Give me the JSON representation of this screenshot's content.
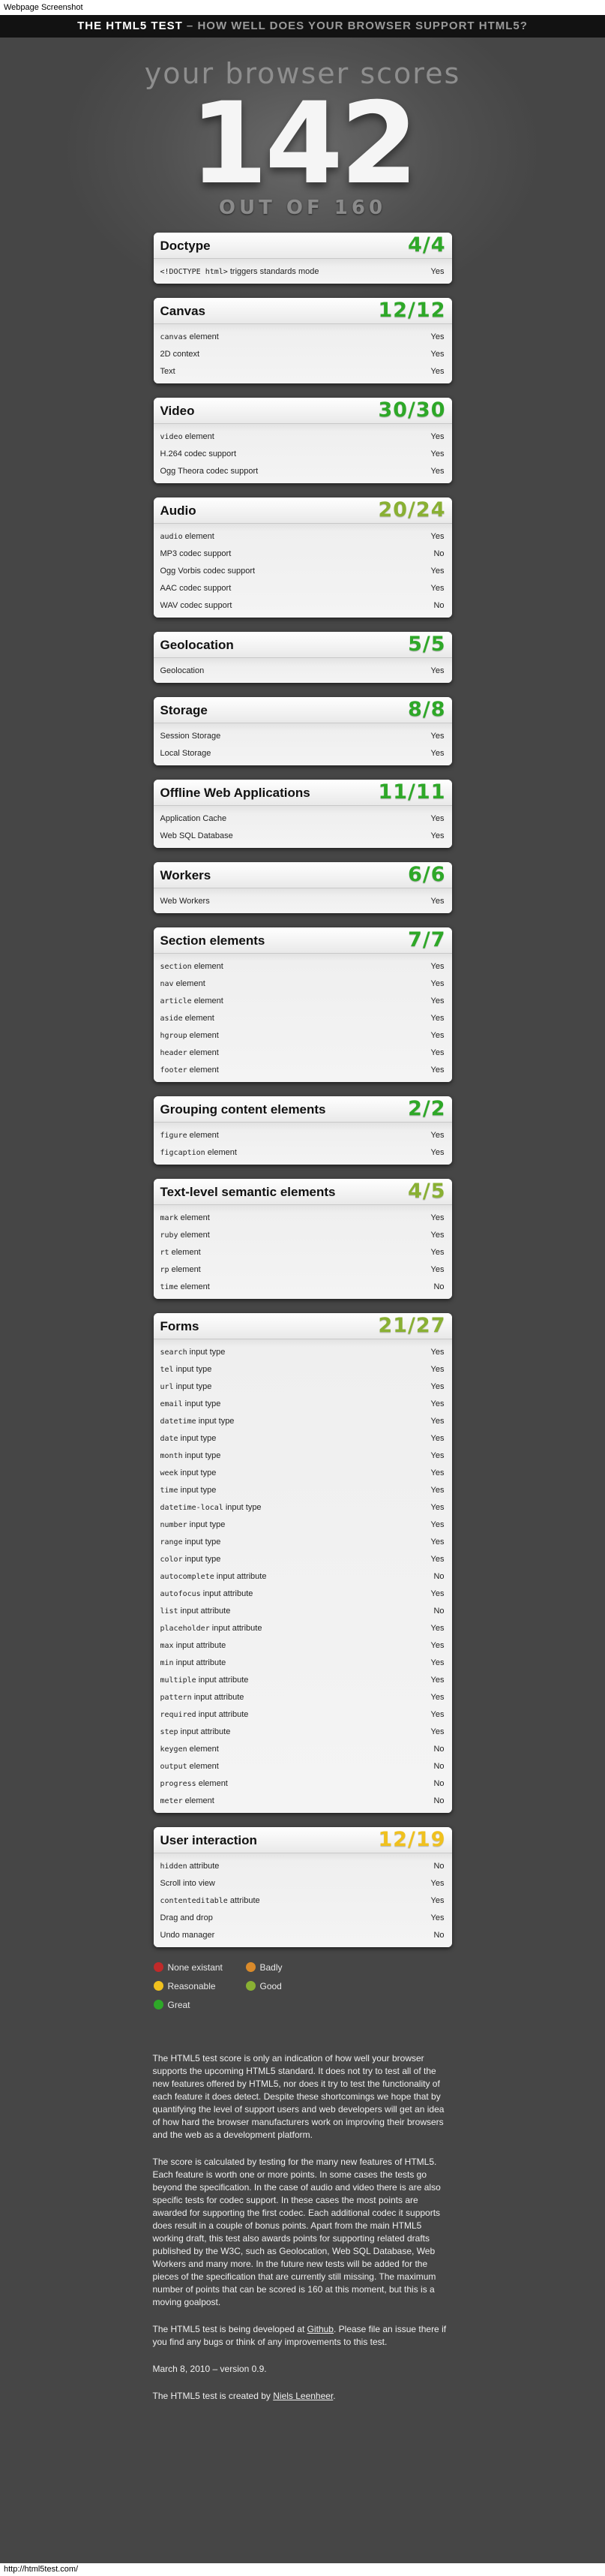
{
  "screenshot_caption": "Webpage Screenshot",
  "status_url": "http://html5test.com/",
  "header": {
    "strong": "THE HTML5 TEST",
    "rest": " – HOW WELL DOES YOUR BROWSER SUPPORT HTML5?"
  },
  "hero": {
    "lead": "your browser scores",
    "score": "142",
    "out_of": "OUT OF 160"
  },
  "colors": {
    "great": "#2ea828",
    "good": "#89b033",
    "reasonable": "#f0c11e",
    "badly": "#d98a2b",
    "none": "#c02a2a"
  },
  "sections": [
    {
      "title": "Doctype",
      "score": "4/4",
      "rating": "great",
      "rows": [
        {
          "pre": "",
          "code": "<!DOCTYPE html>",
          "post": " triggers standards mode",
          "result": "Yes"
        }
      ]
    },
    {
      "title": "Canvas",
      "score": "12/12",
      "rating": "great",
      "rows": [
        {
          "pre": "",
          "code": "canvas",
          "post": " element",
          "result": "Yes"
        },
        {
          "pre": "2D context",
          "code": "",
          "post": "",
          "result": "Yes"
        },
        {
          "pre": "Text",
          "code": "",
          "post": "",
          "result": "Yes"
        }
      ]
    },
    {
      "title": "Video",
      "score": "30/30",
      "rating": "great",
      "rows": [
        {
          "pre": "",
          "code": "video",
          "post": " element",
          "result": "Yes"
        },
        {
          "pre": "H.264 codec support",
          "code": "",
          "post": "",
          "result": "Yes"
        },
        {
          "pre": "Ogg Theora codec support",
          "code": "",
          "post": "",
          "result": "Yes"
        }
      ]
    },
    {
      "title": "Audio",
      "score": "20/24",
      "rating": "good",
      "rows": [
        {
          "pre": "",
          "code": "audio",
          "post": " element",
          "result": "Yes"
        },
        {
          "pre": "MP3 codec support",
          "code": "",
          "post": "",
          "result": "No"
        },
        {
          "pre": "Ogg Vorbis codec support",
          "code": "",
          "post": "",
          "result": "Yes"
        },
        {
          "pre": "AAC codec support",
          "code": "",
          "post": "",
          "result": "Yes"
        },
        {
          "pre": "WAV codec support",
          "code": "",
          "post": "",
          "result": "No"
        }
      ]
    },
    {
      "title": "Geolocation",
      "score": "5/5",
      "rating": "great",
      "rows": [
        {
          "pre": "Geolocation",
          "code": "",
          "post": "",
          "result": "Yes"
        }
      ]
    },
    {
      "title": "Storage",
      "score": "8/8",
      "rating": "great",
      "rows": [
        {
          "pre": "Session Storage",
          "code": "",
          "post": "",
          "result": "Yes"
        },
        {
          "pre": "Local Storage",
          "code": "",
          "post": "",
          "result": "Yes"
        }
      ]
    },
    {
      "title": "Offline Web Applications",
      "score": "11/11",
      "rating": "great",
      "rows": [
        {
          "pre": "Application Cache",
          "code": "",
          "post": "",
          "result": "Yes"
        },
        {
          "pre": "Web SQL Database",
          "code": "",
          "post": "",
          "result": "Yes"
        }
      ]
    },
    {
      "title": "Workers",
      "score": "6/6",
      "rating": "great",
      "rows": [
        {
          "pre": "Web Workers",
          "code": "",
          "post": "",
          "result": "Yes"
        }
      ]
    },
    {
      "title": "Section elements",
      "score": "7/7",
      "rating": "great",
      "rows": [
        {
          "pre": "",
          "code": "section",
          "post": " element",
          "result": "Yes"
        },
        {
          "pre": "",
          "code": "nav",
          "post": " element",
          "result": "Yes"
        },
        {
          "pre": "",
          "code": "article",
          "post": " element",
          "result": "Yes"
        },
        {
          "pre": "",
          "code": "aside",
          "post": " element",
          "result": "Yes"
        },
        {
          "pre": "",
          "code": "hgroup",
          "post": " element",
          "result": "Yes"
        },
        {
          "pre": "",
          "code": "header",
          "post": " element",
          "result": "Yes"
        },
        {
          "pre": "",
          "code": "footer",
          "post": " element",
          "result": "Yes"
        }
      ]
    },
    {
      "title": "Grouping content elements",
      "score": "2/2",
      "rating": "great",
      "rows": [
        {
          "pre": "",
          "code": "figure",
          "post": " element",
          "result": "Yes"
        },
        {
          "pre": "",
          "code": "figcaption",
          "post": " element",
          "result": "Yes"
        }
      ]
    },
    {
      "title": "Text-level semantic elements",
      "score": "4/5",
      "rating": "good",
      "rows": [
        {
          "pre": "",
          "code": "mark",
          "post": " element",
          "result": "Yes"
        },
        {
          "pre": "",
          "code": "ruby",
          "post": " element",
          "result": "Yes"
        },
        {
          "pre": "",
          "code": "rt",
          "post": " element",
          "result": "Yes"
        },
        {
          "pre": "",
          "code": "rp",
          "post": " element",
          "result": "Yes"
        },
        {
          "pre": "",
          "code": "time",
          "post": " element",
          "result": "No"
        }
      ]
    },
    {
      "title": "Forms",
      "score": "21/27",
      "rating": "good",
      "rows": [
        {
          "pre": "",
          "code": "search",
          "post": " input type",
          "result": "Yes"
        },
        {
          "pre": "",
          "code": "tel",
          "post": " input type",
          "result": "Yes"
        },
        {
          "pre": "",
          "code": "url",
          "post": " input type",
          "result": "Yes"
        },
        {
          "pre": "",
          "code": "email",
          "post": " input type",
          "result": "Yes"
        },
        {
          "pre": "",
          "code": "datetime",
          "post": " input type",
          "result": "Yes"
        },
        {
          "pre": "",
          "code": "date",
          "post": " input type",
          "result": "Yes"
        },
        {
          "pre": "",
          "code": "month",
          "post": " input type",
          "result": "Yes"
        },
        {
          "pre": "",
          "code": "week",
          "post": " input type",
          "result": "Yes"
        },
        {
          "pre": "",
          "code": "time",
          "post": " input type",
          "result": "Yes"
        },
        {
          "pre": "",
          "code": "datetime-local",
          "post": " input type",
          "result": "Yes"
        },
        {
          "pre": "",
          "code": "number",
          "post": " input type",
          "result": "Yes"
        },
        {
          "pre": "",
          "code": "range",
          "post": " input type",
          "result": "Yes"
        },
        {
          "pre": "",
          "code": "color",
          "post": " input type",
          "result": "Yes"
        },
        {
          "pre": "",
          "code": "autocomplete",
          "post": " input attribute",
          "result": "No"
        },
        {
          "pre": "",
          "code": "autofocus",
          "post": " input attribute",
          "result": "Yes"
        },
        {
          "pre": "",
          "code": "list",
          "post": " input attribute",
          "result": "No"
        },
        {
          "pre": "",
          "code": "placeholder",
          "post": " input attribute",
          "result": "Yes"
        },
        {
          "pre": "",
          "code": "max",
          "post": " input attribute",
          "result": "Yes"
        },
        {
          "pre": "",
          "code": "min",
          "post": " input attribute",
          "result": "Yes"
        },
        {
          "pre": "",
          "code": "multiple",
          "post": " input attribute",
          "result": "Yes"
        },
        {
          "pre": "",
          "code": "pattern",
          "post": " input attribute",
          "result": "Yes"
        },
        {
          "pre": "",
          "code": "required",
          "post": " input attribute",
          "result": "Yes"
        },
        {
          "pre": "",
          "code": "step",
          "post": " input attribute",
          "result": "Yes"
        },
        {
          "pre": "",
          "code": "keygen",
          "post": " element",
          "result": "No"
        },
        {
          "pre": "",
          "code": "output",
          "post": " element",
          "result": "No"
        },
        {
          "pre": "",
          "code": "progress",
          "post": " element",
          "result": "No"
        },
        {
          "pre": "",
          "code": "meter",
          "post": " element",
          "result": "No"
        }
      ]
    },
    {
      "title": "User interaction",
      "score": "12/19",
      "rating": "reasonable",
      "rows": [
        {
          "pre": "",
          "code": "hidden",
          "post": " attribute",
          "result": "No"
        },
        {
          "pre": "Scroll into view",
          "code": "",
          "post": "",
          "result": "Yes"
        },
        {
          "pre": "",
          "code": "contenteditable",
          "post": " attribute",
          "result": "Yes"
        },
        {
          "pre": "Drag and drop",
          "code": "",
          "post": "",
          "result": "Yes"
        },
        {
          "pre": "Undo manager",
          "code": "",
          "post": "",
          "result": "No"
        }
      ]
    }
  ],
  "legend": [
    {
      "label": "None existant",
      "rating": "none"
    },
    {
      "label": "Badly",
      "rating": "badly"
    },
    {
      "label": "Reasonable",
      "rating": "reasonable"
    },
    {
      "label": "Good",
      "rating": "good"
    },
    {
      "label": "Great",
      "rating": "great"
    }
  ],
  "footer": {
    "p1": "The HTML5 test score is only an indication of how well your browser supports the upcoming HTML5 standard. It does not try to test all of the new features offered by HTML5, nor does it try to test the functionality of each feature it does detect. Despite these shortcomings we hope that by quantifying the level of support users and web developers will get an idea of how hard the browser manufacturers work on improving their browsers and the web as a development platform.",
    "p2": "The score is calculated by testing for the many new features of HTML5. Each feature is worth one or more points. In some cases the tests go beyond the specification. In the case of audio and video there is are also specific tests for codec support. In these cases the most points are awarded for supporting the first codec. Each additional codec it supports does result in a couple of bonus points. Apart from the main HTML5 working draft, this test also awards points for supporting related drafts published by the W3C, such as Geolocation, Web SQL Database, Web Workers and many more. In the future new tests will be added for the pieces of the specification that are currently still missing. The maximum number of points that can be scored is 160 at this moment, but this is a moving goalpost.",
    "p3_before": "The HTML5 test is being developed at ",
    "p3_link": "Github",
    "p3_after": ". Please file an issue there if you find any bugs or think of any improvements to this test.",
    "p4": "March 8, 2010 – version 0.9.",
    "p5_before": "The HTML5 test is created by ",
    "p5_link": "Niels Leenheer",
    "p5_after": "."
  }
}
